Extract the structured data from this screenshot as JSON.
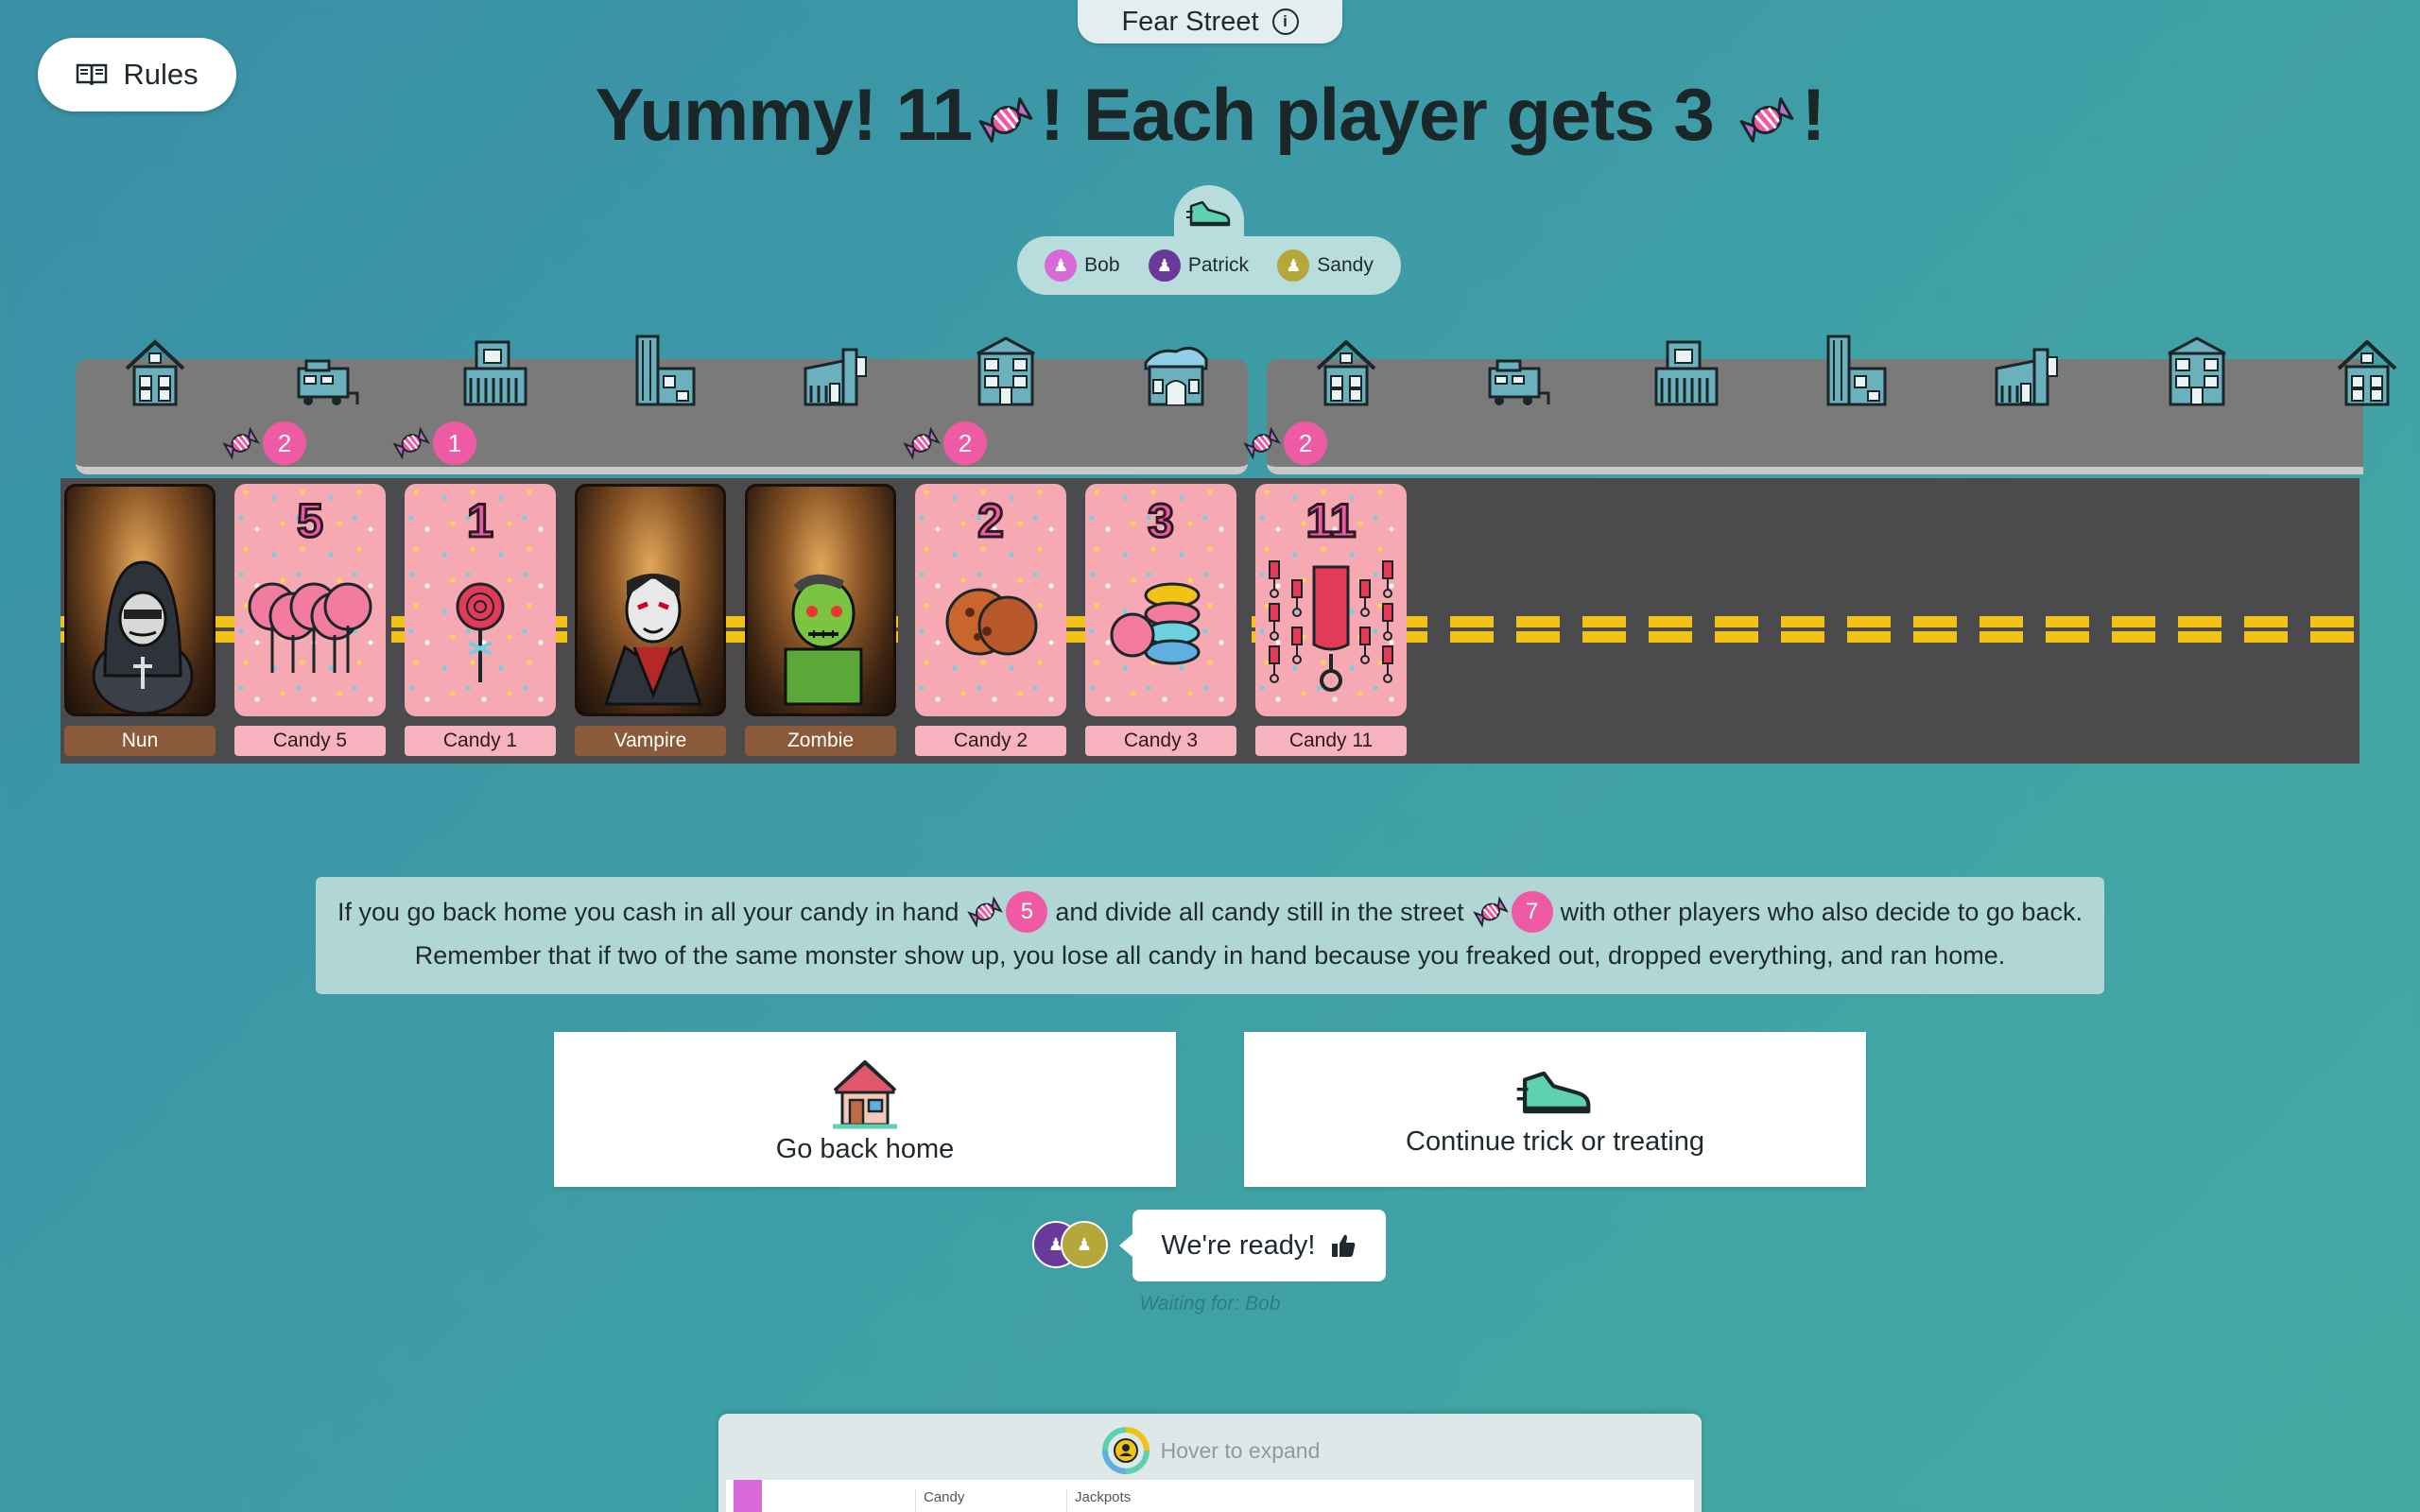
{
  "header": {
    "street_name": "Fear Street",
    "rules_label": "Rules",
    "headline_part1": "Yummy! 11",
    "headline_part2": "! Each player gets 3",
    "headline_part3": "!"
  },
  "players": [
    {
      "name": "Bob",
      "color": "#d86ad8"
    },
    {
      "name": "Patrick",
      "color": "#6a3a9a"
    },
    {
      "name": "Sandy",
      "color": "#b5a83a"
    }
  ],
  "street": {
    "houses": [
      "house",
      "trailer",
      "apartment",
      "tower",
      "shop",
      "townhouse",
      "cottage",
      "house",
      "trailer",
      "apartment",
      "tower",
      "shop",
      "townhouse",
      "house"
    ],
    "house_candy": [
      {
        "house_index": 1,
        "count": "2"
      },
      {
        "house_index": 2,
        "count": "1"
      },
      {
        "house_index": 5,
        "count": "2"
      },
      {
        "house_index": 7,
        "count": "2"
      }
    ],
    "cards": [
      {
        "label": "Nun",
        "kind": "monster",
        "value": ""
      },
      {
        "label": "Candy 5",
        "kind": "candy",
        "value": "5"
      },
      {
        "label": "Candy 1",
        "kind": "candy",
        "value": "1"
      },
      {
        "label": "Vampire",
        "kind": "monster",
        "value": ""
      },
      {
        "label": "Zombie",
        "kind": "monster",
        "value": ""
      },
      {
        "label": "Candy 2",
        "kind": "candy",
        "value": "2"
      },
      {
        "label": "Candy 3",
        "kind": "candy",
        "value": "3"
      },
      {
        "label": "Candy 11",
        "kind": "candy",
        "value": "11"
      }
    ]
  },
  "info": {
    "line1_a": "If you go back home you cash in all your candy in hand",
    "hand_candy": "5",
    "line1_b": "and divide all candy still in the street",
    "street_candy": "7",
    "line1_c": "with other players who also decide to go back.",
    "line2": "Remember that if two of the same monster show up, you lose all candy in hand because you freaked out, dropped everything, and ran home."
  },
  "actions": {
    "home_label": "Go back home",
    "continue_label": "Continue trick or treating"
  },
  "ready": {
    "label": "We're ready!",
    "waiting": "Waiting for: Bob"
  },
  "bottom_panel": {
    "hover_label": "Hover to expand",
    "columns": [
      "Candy",
      "Jackpots"
    ]
  },
  "colors": {
    "candy_pink": "#ee5aa3",
    "road": "#4b4b4d",
    "lane_yellow": "#f2c314"
  }
}
